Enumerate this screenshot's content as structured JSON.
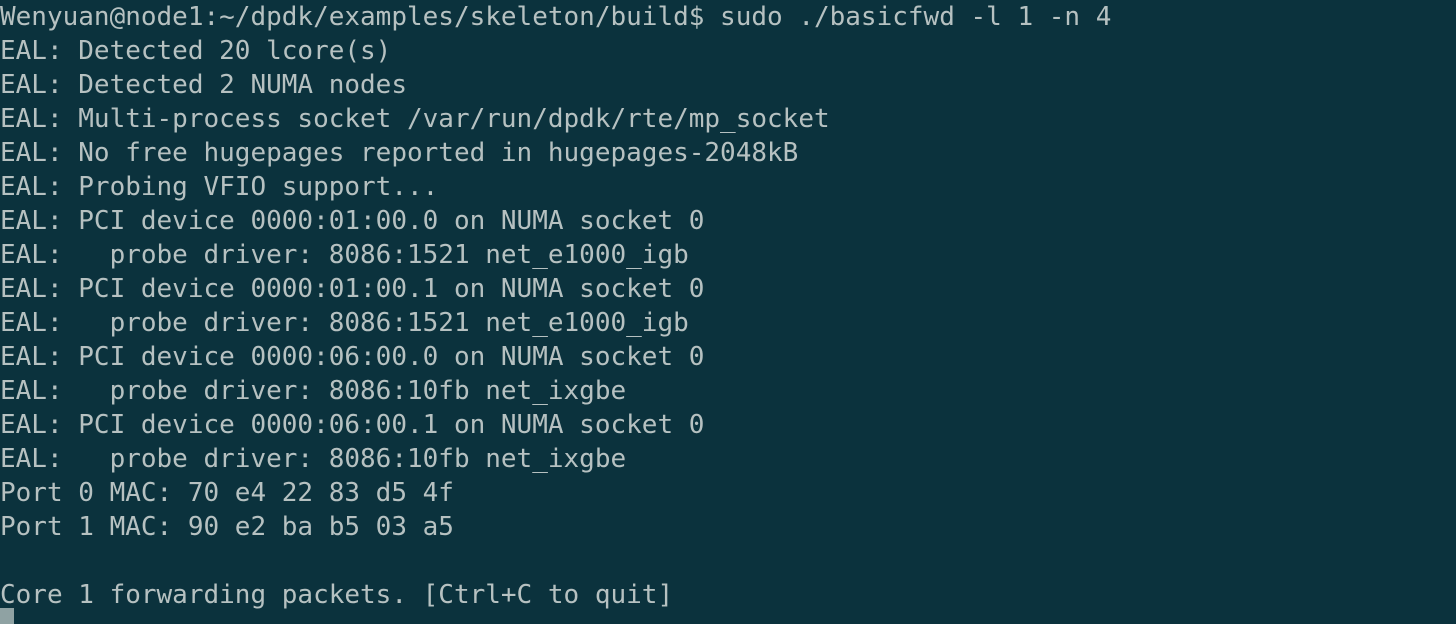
{
  "terminal": {
    "colors": {
      "background": "#0b323d",
      "text": "#b6c1c1",
      "cursor": "#8fa2a3"
    },
    "lines": [
      "Wenyuan@node1:~/dpdk/examples/skeleton/build$ sudo ./basicfwd -l 1 -n 4",
      "EAL: Detected 20 lcore(s)",
      "EAL: Detected 2 NUMA nodes",
      "EAL: Multi-process socket /var/run/dpdk/rte/mp_socket",
      "EAL: No free hugepages reported in hugepages-2048kB",
      "EAL: Probing VFIO support...",
      "EAL: PCI device 0000:01:00.0 on NUMA socket 0",
      "EAL:   probe driver: 8086:1521 net_e1000_igb",
      "EAL: PCI device 0000:01:00.1 on NUMA socket 0",
      "EAL:   probe driver: 8086:1521 net_e1000_igb",
      "EAL: PCI device 0000:06:00.0 on NUMA socket 0",
      "EAL:   probe driver: 8086:10fb net_ixgbe",
      "EAL: PCI device 0000:06:00.1 on NUMA socket 0",
      "EAL:   probe driver: 8086:10fb net_ixgbe",
      "Port 0 MAC: 70 e4 22 83 d5 4f",
      "Port 1 MAC: 90 e2 ba b5 03 a5",
      "",
      "Core 1 forwarding packets. [Ctrl+C to quit]"
    ]
  }
}
